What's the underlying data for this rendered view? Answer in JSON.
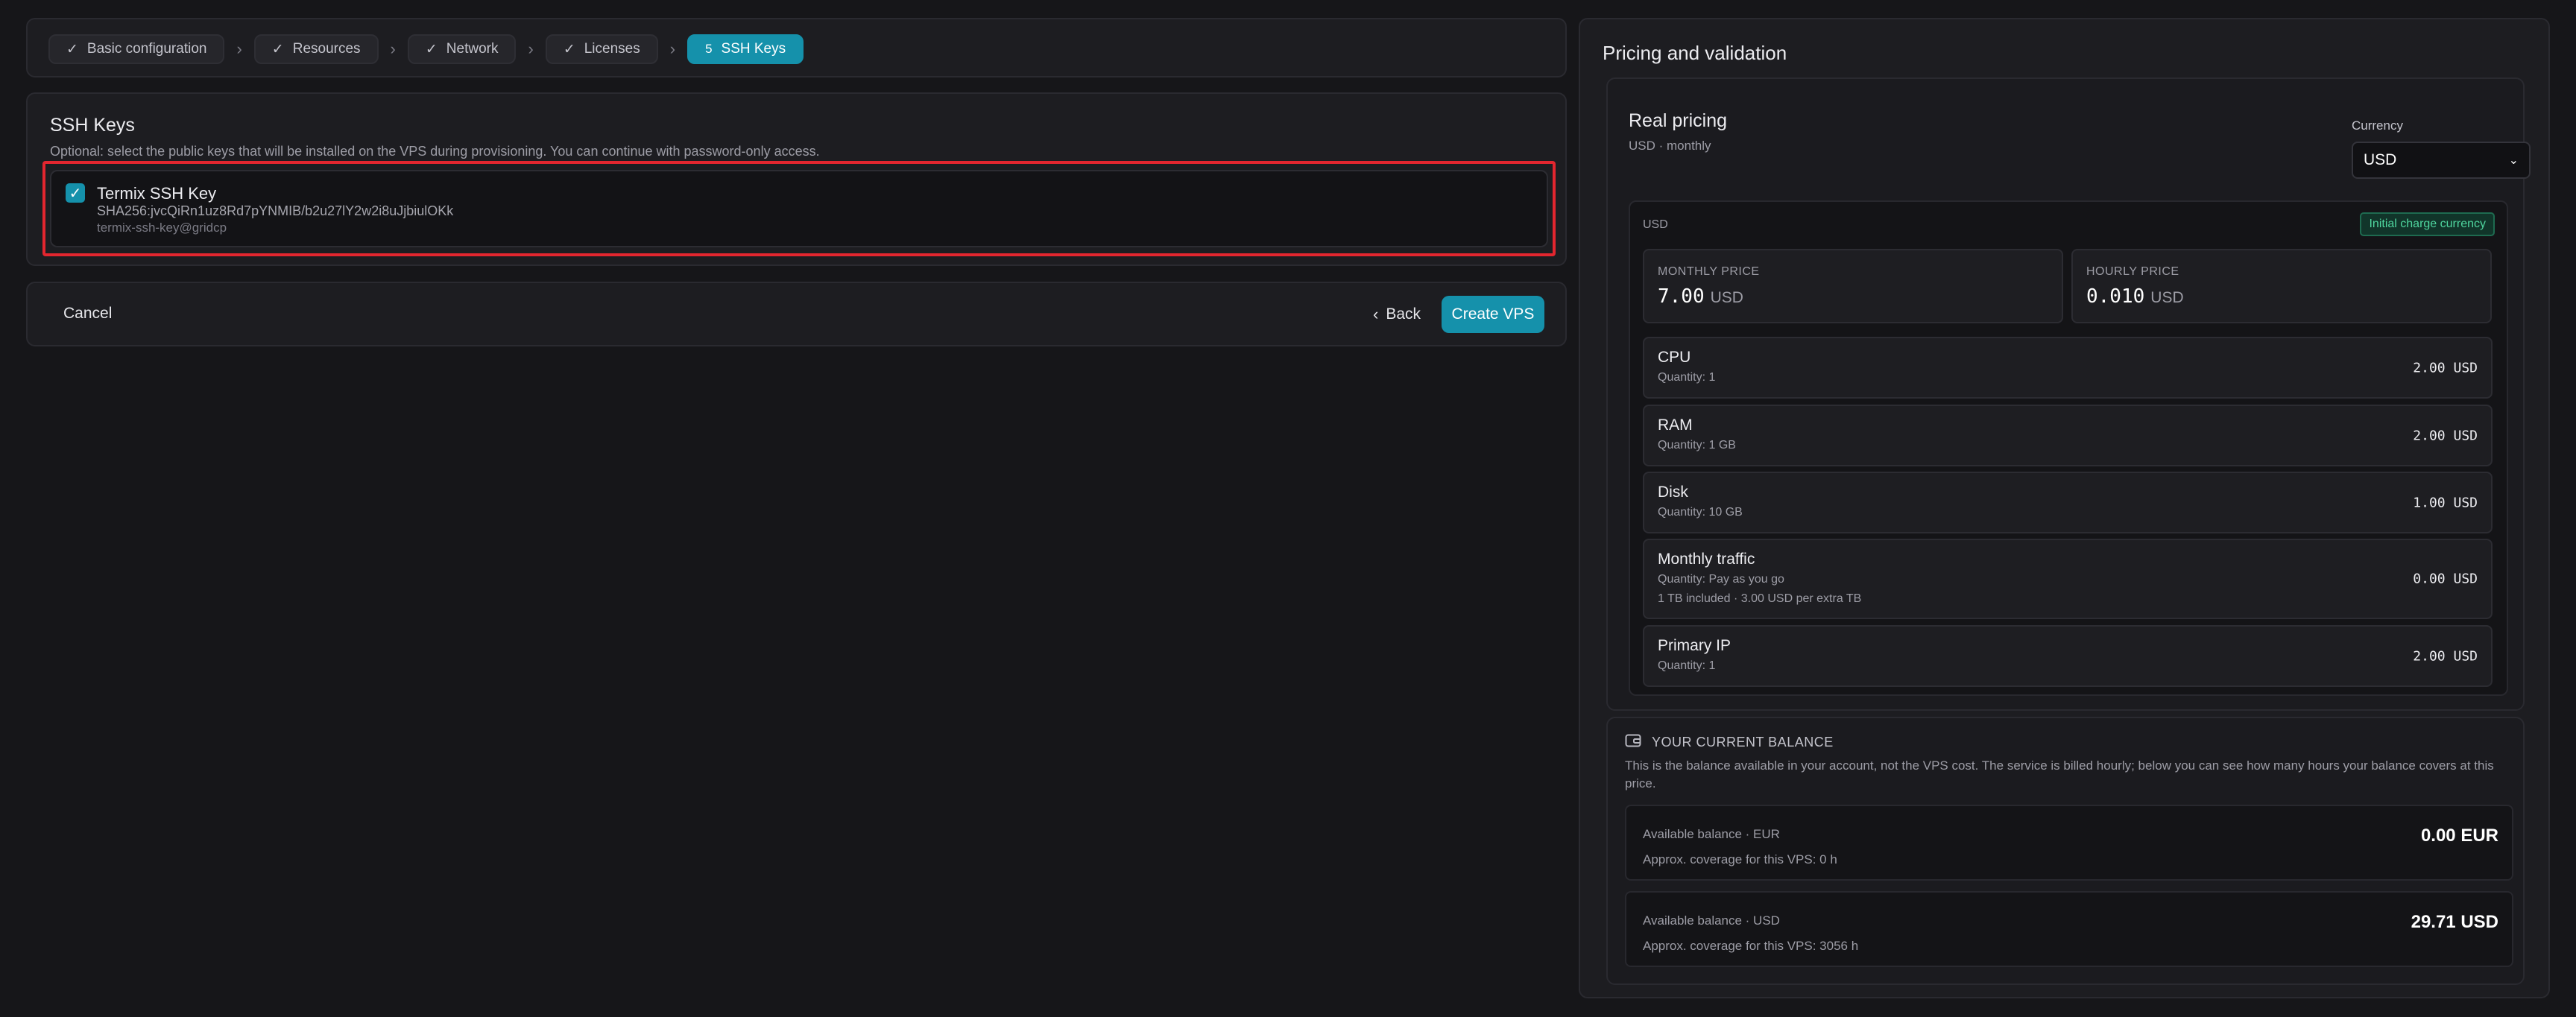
{
  "stepper": {
    "steps": [
      {
        "label": "Basic configuration",
        "done": true
      },
      {
        "label": "Resources",
        "done": true
      },
      {
        "label": "Network",
        "done": true
      },
      {
        "label": "Licenses",
        "done": true
      },
      {
        "label": "SSH Keys",
        "number": "5",
        "active": true
      }
    ]
  },
  "ssh": {
    "title": "SSH Keys",
    "description": "Optional: select the public keys that will be installed on the VPS during provisioning. You can continue with password-only access.",
    "keys": [
      {
        "name": "Termix SSH Key",
        "fingerprint": "SHA256:jvcQiRn1uz8Rd7pYNMIB/b2u27lY2w2i8uJjbiulOKk",
        "comment": "termix-ssh-key@gridcp",
        "checked": true
      }
    ]
  },
  "actions": {
    "cancel": "Cancel",
    "back": "Back",
    "create": "Create VPS"
  },
  "pricing": {
    "title": "Pricing and validation",
    "real_pricing_title": "Real pricing",
    "real_pricing_subtitle": "USD · monthly",
    "currency_label": "Currency",
    "currency_value": "USD",
    "box_currency": "USD",
    "badge": "Initial charge currency",
    "monthly": {
      "label": "MONTHLY PRICE",
      "value": "7.00",
      "unit": "USD"
    },
    "hourly": {
      "label": "HOURLY PRICE",
      "value": "0.010",
      "unit": "USD"
    },
    "items": [
      {
        "name": "CPU",
        "quantity": "Quantity: 1",
        "price": "2.00 USD"
      },
      {
        "name": "RAM",
        "quantity": "Quantity: 1 GB",
        "price": "2.00 USD"
      },
      {
        "name": "Disk",
        "quantity": "Quantity: 10 GB",
        "price": "1.00 USD"
      },
      {
        "name": "Monthly traffic",
        "quantity": "Quantity: Pay as you go",
        "extra": "1 TB included · 3.00 USD per extra TB",
        "price": "0.00 USD"
      },
      {
        "name": "Primary IP",
        "quantity": "Quantity: 1",
        "price": "2.00 USD"
      }
    ]
  },
  "balance": {
    "heading": "YOUR CURRENT BALANCE",
    "description": "This is the balance available in your account, not the VPS cost. The service is billed hourly; below you can see how many hours your balance covers at this price.",
    "accounts": [
      {
        "label": "Available balance · EUR",
        "coverage": "Approx. coverage for this VPS: 0 h",
        "value": "0.00 EUR"
      },
      {
        "label": "Available balance · USD",
        "coverage": "Approx. coverage for this VPS: 3056 h",
        "value": "29.71 USD"
      }
    ]
  },
  "colors": {
    "accent": "#1591ab",
    "highlight_border": "#e3262f",
    "badge_text": "#4fd69f"
  },
  "icons": {
    "step_done": "check-icon",
    "separator": "chevron-right-icon",
    "back": "chevron-left-icon",
    "select": "chevron-down-icon",
    "balance": "wallet-icon"
  }
}
